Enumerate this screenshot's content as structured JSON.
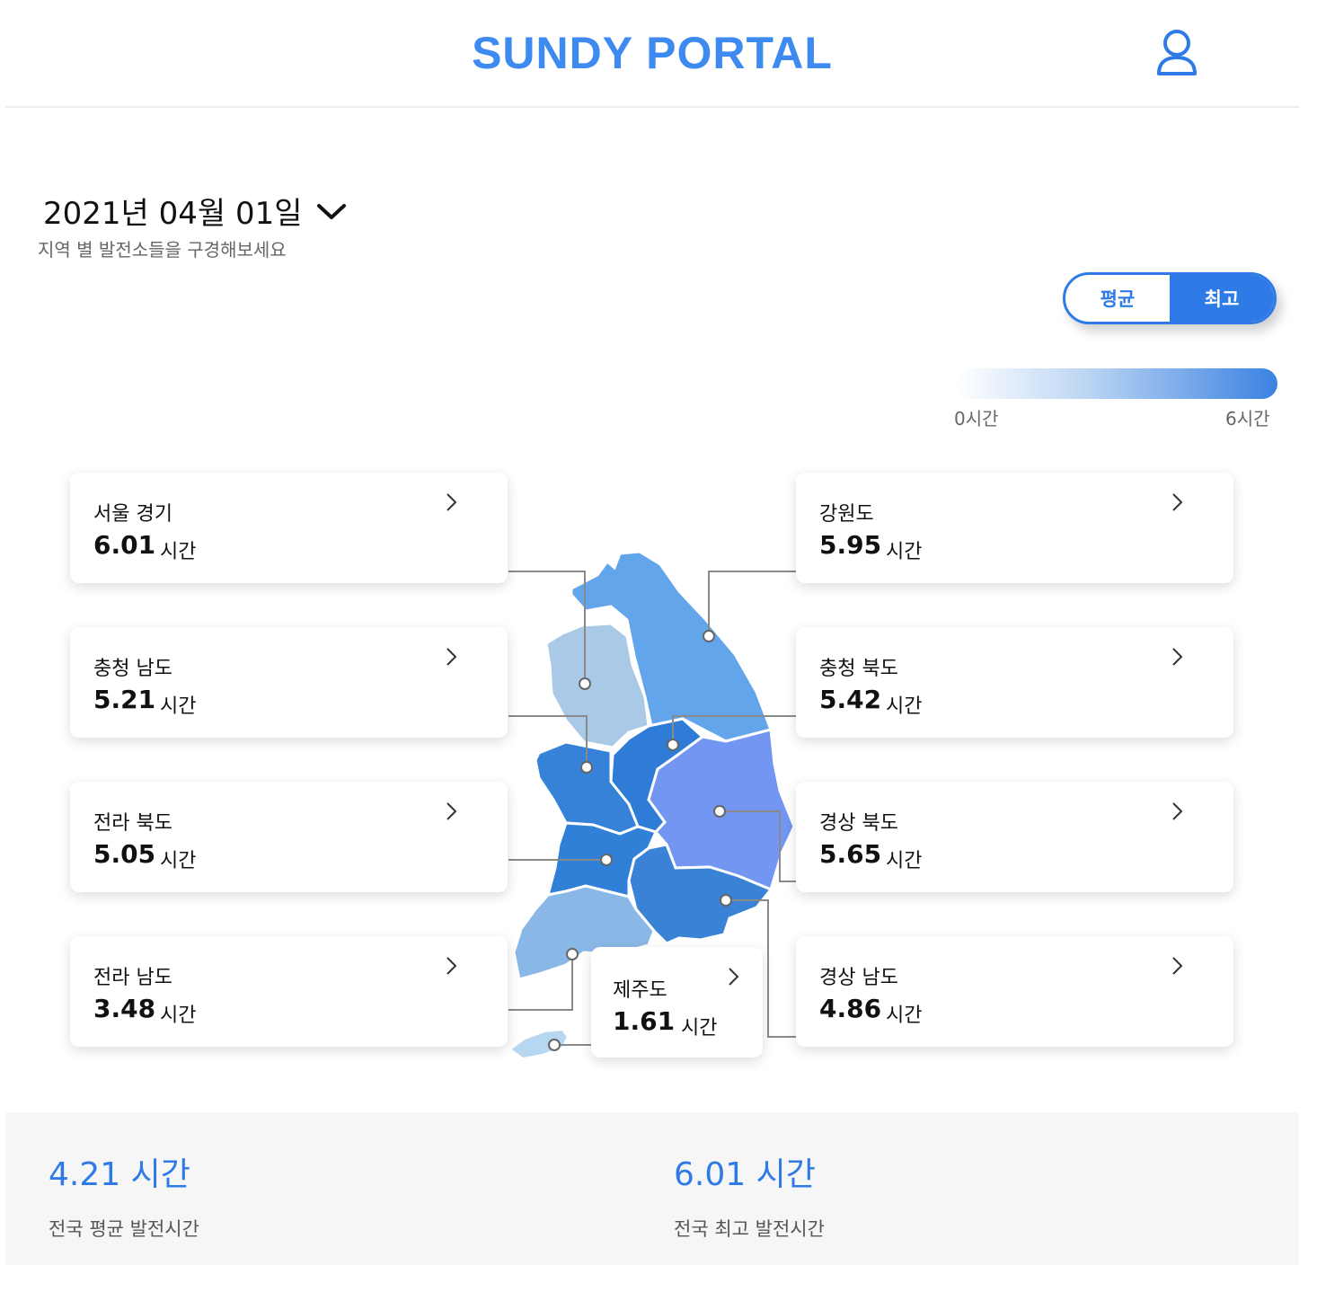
{
  "header": {
    "brand": "SUNDY PORTAL",
    "user_icon": "user-icon"
  },
  "date": {
    "label": "2021년 04월 01일",
    "subtitle": "지역 별 발전소들을 구경해보세요"
  },
  "toggle": {
    "avg_label": "평균",
    "max_label": "최고",
    "selected": "최고"
  },
  "legend": {
    "min_label": "0시간",
    "max_label": "6시간",
    "color_from": "#ffffff",
    "color_to": "#3a82e2"
  },
  "unit": "시간",
  "regions": {
    "seoul_gyeonggi": {
      "name": "서울 경기",
      "value": "6.01"
    },
    "chungnam": {
      "name": "충청 남도",
      "value": "5.21"
    },
    "jeonbuk": {
      "name": "전라 북도",
      "value": "5.05"
    },
    "jeonnam": {
      "name": "전라 남도",
      "value": "3.48"
    },
    "gangwon": {
      "name": "강원도",
      "value": "5.95"
    },
    "chungbuk": {
      "name": "충청 북도",
      "value": "5.42"
    },
    "gyeongbuk": {
      "name": "경상 북도",
      "value": "5.65"
    },
    "gyeongnam": {
      "name": "경상 남도",
      "value": "4.86"
    },
    "jeju": {
      "name": "제주도",
      "value": "1.61"
    }
  },
  "summary": {
    "avg_value": "4.21 시간",
    "avg_label": "전국 평균 발전시간",
    "max_value": "6.01 시간",
    "max_label": "전국 최고 발전시간"
  },
  "colors": {
    "accent": "#2e7ae6",
    "brand": "#3d8af0"
  }
}
